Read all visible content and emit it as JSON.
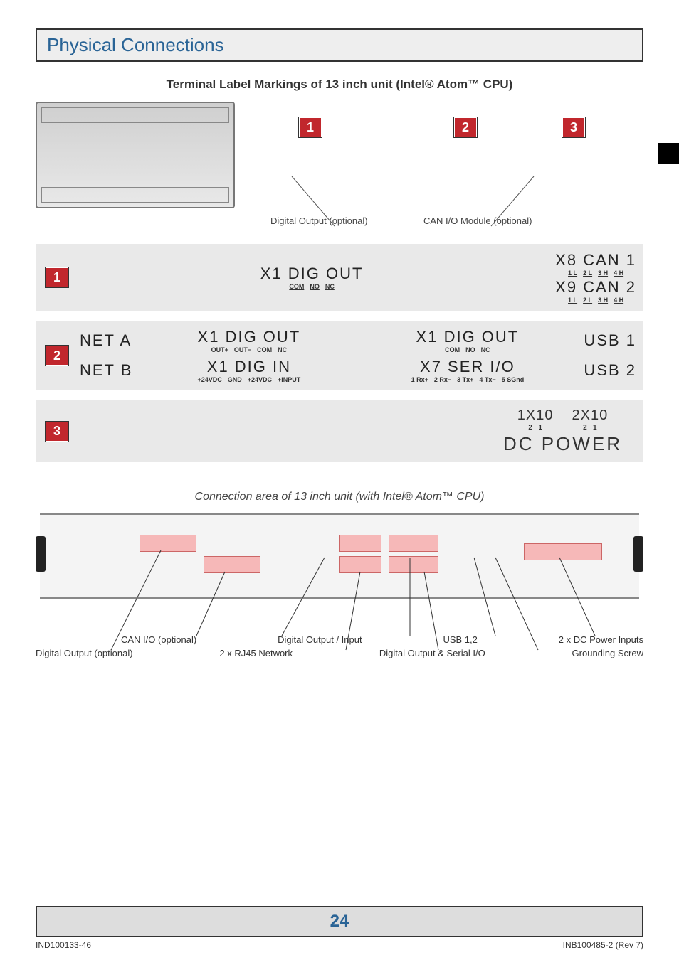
{
  "header": {
    "title": "Physical Connections"
  },
  "subtitle": "Terminal Label Markings of 13 inch unit (Intel® Atom™ CPU)",
  "top_callouts": {
    "n1": "1",
    "n2": "2",
    "n3": "3"
  },
  "top_labels": {
    "digital_output": "Digital Output (optional)",
    "can_io": "CAN I/O Module (optional)"
  },
  "row1": {
    "num": "1",
    "x1": {
      "title": "X1 DIG OUT",
      "pins": [
        "COM",
        "NO",
        "NC"
      ]
    },
    "x8": {
      "title": "X8 CAN 1",
      "pins": [
        "1 L",
        "2 L",
        "3 H",
        "4 H"
      ]
    },
    "x9": {
      "title": "X9 CAN 2",
      "pins": [
        "1 L",
        "2 L",
        "3 H",
        "4 H"
      ]
    }
  },
  "row2": {
    "num": "2",
    "neta": "NET A",
    "netb": "NET B",
    "t1": {
      "title": "X1 DIG OUT",
      "pins": [
        "OUT+",
        "OUT−",
        "COM",
        "NC"
      ]
    },
    "t2": {
      "title": "X1 DIG IN",
      "pins": [
        "+24VDC",
        "GND",
        "+24VDC",
        "+INPUT"
      ]
    },
    "t3": {
      "title": "X1 DIG OUT",
      "pins": [
        "COM",
        "NO",
        "NC"
      ]
    },
    "t4": {
      "title": "X7 SER I/O",
      "pins": [
        "1 Rx+",
        "2 Rx−",
        "3 Tx+",
        "4 Tx−",
        "5 SGnd"
      ]
    },
    "usb1": "USB 1",
    "usb2": "USB 2"
  },
  "row3": {
    "num": "3",
    "b1": {
      "title": "1X10",
      "pins": [
        "2",
        "1"
      ]
    },
    "b2": {
      "title": "2X10",
      "pins": [
        "2",
        "1"
      ]
    },
    "dc": "DC POWER"
  },
  "conn_caption": "Connection area of 13 inch unit (with Intel® Atom™ CPU)",
  "bottom_labels_row1": {
    "a": "CAN I/O (optional)",
    "b": "Digital Output / Input",
    "c": "USB 1,2",
    "d": "2 x DC Power Inputs"
  },
  "bottom_labels_row2": {
    "a": "Digital Output (optional)",
    "b": "2 x RJ45 Network",
    "c": "Digital Output & Serial I/O",
    "d": "Grounding Screw"
  },
  "footer": {
    "page": "24",
    "left": "IND100133-46",
    "right": "INB100485-2 (Rev 7)"
  }
}
